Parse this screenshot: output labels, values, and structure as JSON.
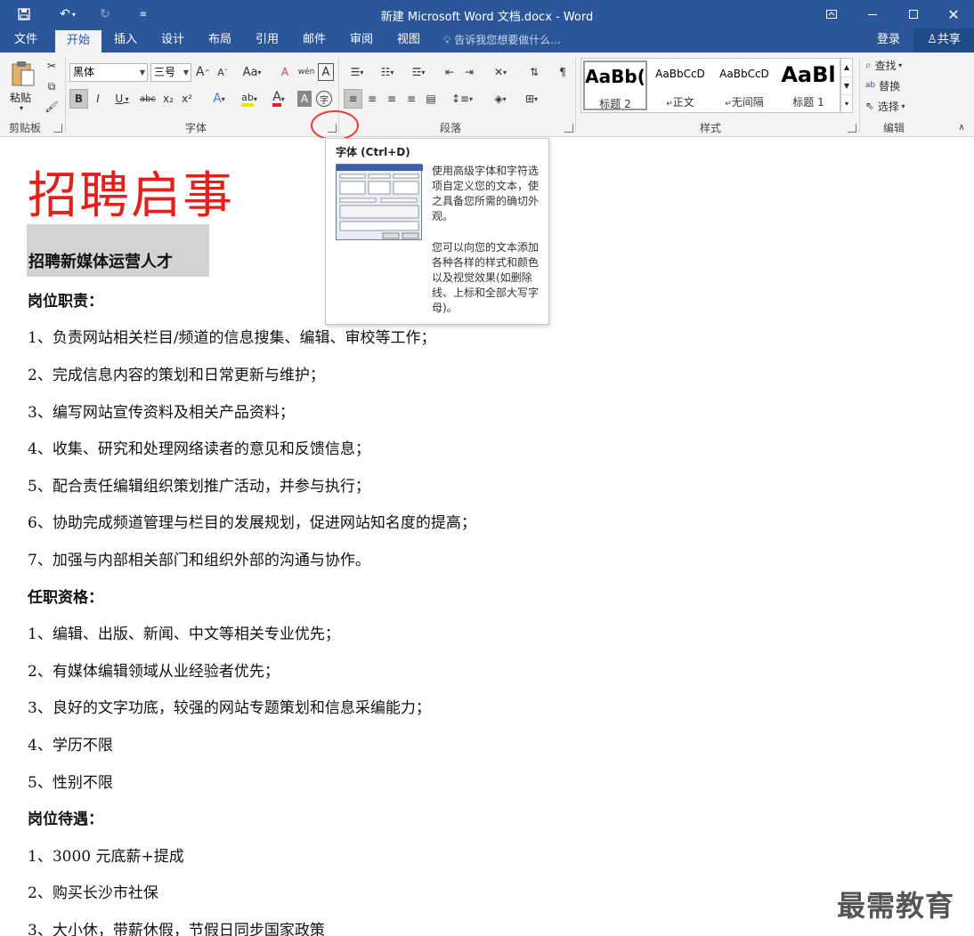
{
  "window": {
    "title": "新建 Microsoft Word 文档.docx - Word"
  },
  "menu": {
    "tabs": [
      "文件",
      "开始",
      "插入",
      "设计",
      "布局",
      "引用",
      "邮件",
      "审阅",
      "视图"
    ],
    "active_tab": "开始",
    "tell_me": "告诉我您想要做什么...",
    "login": "登录",
    "share": "共享"
  },
  "ribbon": {
    "clipboard": {
      "label": "剪贴板",
      "paste": "粘贴"
    },
    "font": {
      "label": "字体",
      "font_name": "黑体",
      "font_size": "三号",
      "grow": "A",
      "shrink": "A",
      "case": "Aa",
      "clear": "A",
      "phonetic": "wén",
      "border_char": "A",
      "bold": "B",
      "italic": "I",
      "underline": "U",
      "strike": "abc",
      "sub": "x₂",
      "sup": "x²",
      "effects": "A",
      "highlight": "ab",
      "color": "A",
      "shade": "A",
      "enclose": "字"
    },
    "paragraph": {
      "label": "段落"
    },
    "styles": {
      "label": "样式",
      "items": [
        {
          "preview": "AaBb(",
          "name": "标题 2"
        },
        {
          "preview": "AaBbCcD",
          "name": "正文"
        },
        {
          "preview": "AaBbCcD",
          "name": "无间隔"
        },
        {
          "preview": "AaBl",
          "name": "标题 1"
        }
      ]
    },
    "editing": {
      "label": "编辑",
      "find": "查找",
      "replace": "替换",
      "select": "选择"
    }
  },
  "tooltip": {
    "title": "字体 (Ctrl+D)",
    "para1": "使用高级字体和字符选项自定义您的文本，使之具备您所需的确切外观。",
    "para2": "您可以向您的文本添加各种各样的样式和颜色以及视觉效果(如删除线、上标和全部大写字母)。"
  },
  "document": {
    "title": "招聘启事",
    "subheading": "招聘新媒体运营人才",
    "section1": "岗位职责：",
    "duties": [
      "1、负责网站相关栏目/频道的信息搜集、编辑、审校等工作；",
      "2、完成信息内容的策划和日常更新与维护；",
      "3、编写网站宣传资料及相关产品资料；",
      "4、收集、研究和处理网络读者的意见和反馈信息；",
      "5、配合责任编辑组织策划推广活动，并参与执行；",
      "6、协助完成频道管理与栏目的发展规划，促进网站知名度的提高；",
      "7、加强与内部相关部门和组织外部的沟通与协作。"
    ],
    "section2": "任职资格：",
    "quals": [
      "1、编辑、出版、新闻、中文等相关专业优先；",
      "2、有媒体编辑领域从业经验者优先；",
      "3、良好的文字功底，较强的网站专题策划和信息采编能力；",
      "4、学历不限",
      "5、性别不限"
    ],
    "section3": "岗位待遇：",
    "benefits": [
      "1、3000 元底薪+提成",
      "2、购买长沙市社保",
      "3、大小休，带薪休假，节假日同步国家政策"
    ]
  },
  "watermark": "最需教育",
  "colors": {
    "brand": "#2b579a",
    "title_red": "#e3211c",
    "highlight_circle": "#e23a33"
  }
}
